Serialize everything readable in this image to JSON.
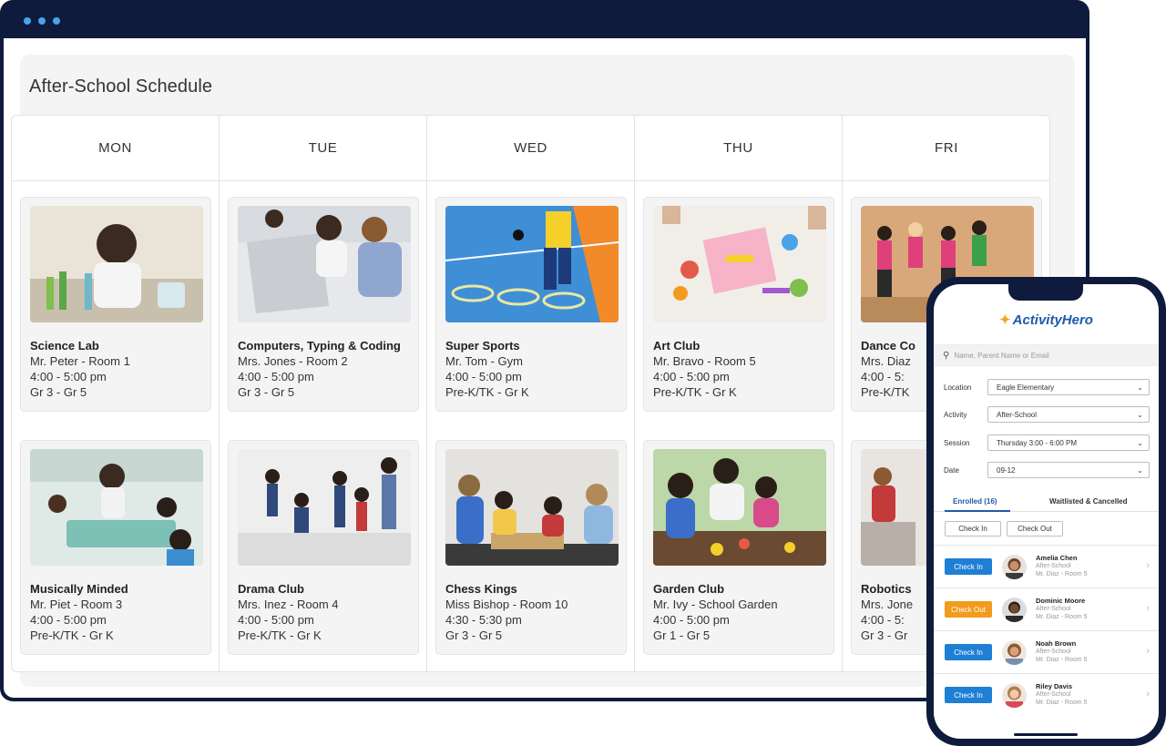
{
  "schedule": {
    "title": "After-School Schedule",
    "days": [
      "MON",
      "TUE",
      "WED",
      "THU",
      "FRI"
    ],
    "columns": [
      {
        "cards": [
          {
            "title": "Science Lab",
            "teacher": "Mr. Peter - Room 1",
            "time": "4:00 - 5:00 pm",
            "grades": "Gr 3 - Gr 5"
          },
          {
            "title": "Musically Minded",
            "teacher": "Mr. Piet - Room 3",
            "time": "4:00 - 5:00 pm",
            "grades": "Pre-K/TK - Gr K"
          }
        ]
      },
      {
        "cards": [
          {
            "title": "Computers, Typing & Coding",
            "teacher": "Mrs. Jones - Room 2",
            "time": "4:00 - 5:00 pm",
            "grades": "Gr 3 - Gr 5"
          },
          {
            "title": "Drama Club",
            "teacher": "Mrs. Inez - Room 4",
            "time": "4:00 - 5:00 pm",
            "grades": "Pre-K/TK - Gr K"
          }
        ]
      },
      {
        "cards": [
          {
            "title": "Super Sports",
            "teacher": "Mr. Tom - Gym",
            "time": "4:00 - 5:00 pm",
            "grades": "Pre-K/TK - Gr K"
          },
          {
            "title": "Chess Kings",
            "teacher": "Miss Bishop - Room 10",
            "time": "4:30 - 5:30 pm",
            "grades": "Gr 3 - Gr 5"
          }
        ]
      },
      {
        "cards": [
          {
            "title": "Art Club",
            "teacher": "Mr. Bravo - Room 5",
            "time": "4:00 - 5:00 pm",
            "grades": "Pre-K/TK - Gr K"
          },
          {
            "title": "Garden Club",
            "teacher": "Mr. Ivy - School Garden",
            "time": "4:00 - 5:00 pm",
            "grades": "Gr 1 - Gr 5"
          }
        ]
      },
      {
        "cards": [
          {
            "title": "Dance Co",
            "teacher": "Mrs. Diaz",
            "time": "4:00 - 5:",
            "grades": "Pre-K/TK"
          },
          {
            "title": "Robotics",
            "teacher": "Mrs. Jone",
            "time": "4:00 - 5:",
            "grades": "Gr 3 - Gr"
          }
        ]
      }
    ]
  },
  "phone": {
    "brand": "ActivityHero",
    "search_placeholder": "Name, Parent Name or Email",
    "filters": [
      {
        "label": "Location",
        "value": "Eagle Elementary"
      },
      {
        "label": "Activity",
        "value": "After-School"
      },
      {
        "label": "Session",
        "value": "Thursday 3:00 - 6:00 PM"
      },
      {
        "label": "Date",
        "value": "09-12"
      }
    ],
    "tabs": {
      "enrolled": "Enrolled (16)",
      "waitlisted": "Waitlisted & Cancelled"
    },
    "actions": {
      "check_in": "Check In",
      "check_out": "Check Out"
    },
    "roster": [
      {
        "button": "Check In",
        "state": "in",
        "name": "Amelia Chen",
        "activity": "After-School",
        "location": "Mr. Diaz - Room 5"
      },
      {
        "button": "Check Out",
        "state": "out",
        "name": "Dominic Moore",
        "activity": "After-School",
        "location": "Mr. Diaz - Room 5"
      },
      {
        "button": "Check In",
        "state": "in",
        "name": "Noah Brown",
        "activity": "After-School",
        "location": "Mr. Diaz - Room 5"
      },
      {
        "button": "Check In",
        "state": "in",
        "name": "Riley Davis",
        "activity": "After-School",
        "location": "Mr. Diaz - Room 5"
      }
    ]
  },
  "colors": {
    "frame": "#0f1b3d",
    "accent": "#1f5aa8",
    "check_in": "#1e7fd4",
    "check_out": "#f29b1d"
  }
}
